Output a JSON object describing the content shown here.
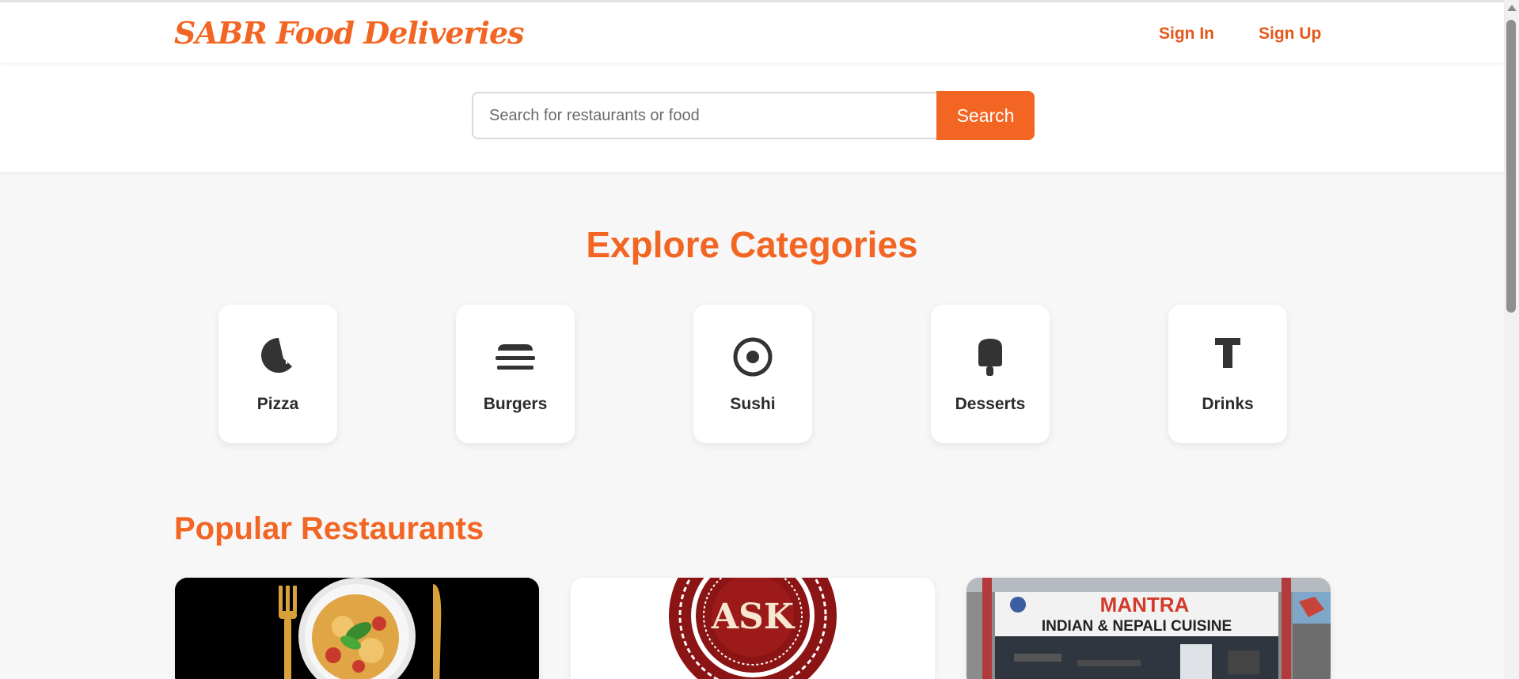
{
  "header": {
    "logo": "SABR Food Deliveries",
    "sign_in": "Sign In",
    "sign_up": "Sign Up"
  },
  "search": {
    "placeholder": "Search for restaurants or food",
    "button": "Search"
  },
  "categories_section": {
    "title": "Explore Categories",
    "items": [
      {
        "label": "Pizza",
        "icon": "pizza-icon"
      },
      {
        "label": "Burgers",
        "icon": "burger-icon"
      },
      {
        "label": "Sushi",
        "icon": "sushi-icon"
      },
      {
        "label": "Desserts",
        "icon": "ice-cream-icon"
      },
      {
        "label": "Drinks",
        "icon": "cocktail-icon"
      }
    ]
  },
  "restaurants_section": {
    "title": "Popular Restaurants",
    "cards": [
      {
        "image": "pasta-plate-image"
      },
      {
        "image": "ask-logo-image",
        "logo_text": "ASK"
      },
      {
        "image": "mantra-storefront-image",
        "sign_line1": "MANTRA",
        "sign_line2": "INDIAN & NEPALI CUISINE"
      }
    ]
  },
  "colors": {
    "accent": "#f26522",
    "background": "#f7f7f7",
    "card": "#ffffff",
    "text": "#2b2b2b"
  }
}
